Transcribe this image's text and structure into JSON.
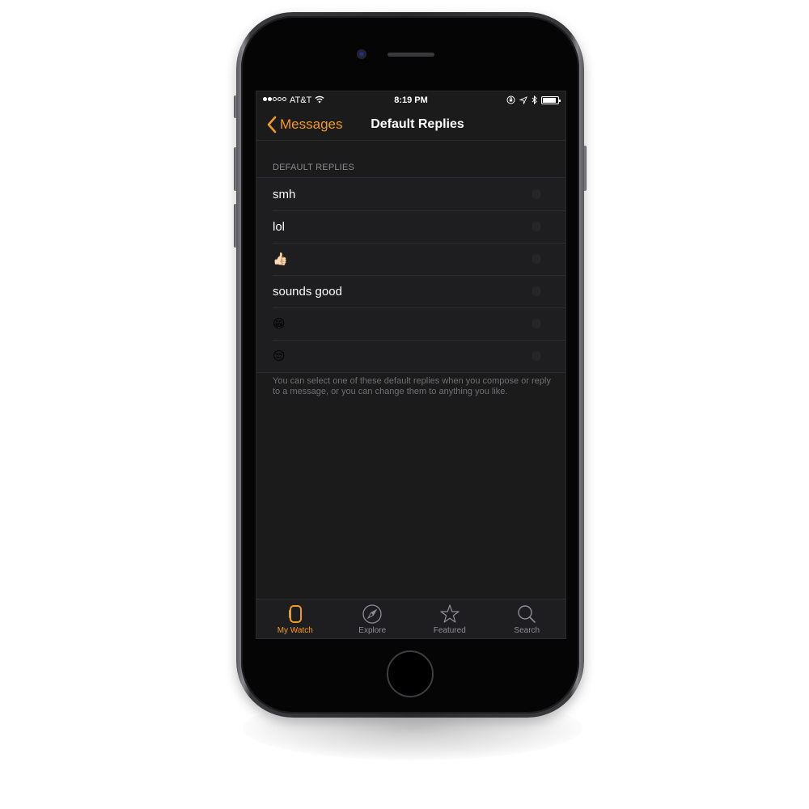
{
  "status_bar": {
    "signal_bars_filled": 2,
    "signal_bars_total": 5,
    "carrier": "AT&T",
    "time": "8:19 PM",
    "battery_level": 0.9,
    "icons": [
      "wifi-icon",
      "orientation-lock-icon",
      "location-icon",
      "bluetooth-icon",
      "battery-icon"
    ]
  },
  "nav": {
    "back_label": "Messages",
    "title": "Default Replies"
  },
  "section": {
    "header": "DEFAULT REPLIES",
    "items": [
      {
        "label": "smh",
        "type": "text"
      },
      {
        "label": "lol",
        "type": "text"
      },
      {
        "label": "👍🏻",
        "type": "emoji",
        "name": "thumbs-up"
      },
      {
        "label": "sounds good",
        "type": "text"
      },
      {
        "label": "😁",
        "type": "emoji",
        "name": "grinning-face"
      },
      {
        "label": "😒",
        "type": "emoji",
        "name": "unamused-face"
      }
    ],
    "footer": "You can select one of these default replies when you compose or reply to a message, or you can change them to anything you like."
  },
  "tab_bar": {
    "tabs": [
      {
        "label": "My Watch",
        "icon": "watch-icon",
        "active": true
      },
      {
        "label": "Explore",
        "icon": "compass-icon",
        "active": false
      },
      {
        "label": "Featured",
        "icon": "star-icon",
        "active": false
      },
      {
        "label": "Search",
        "icon": "search-icon",
        "active": false
      }
    ]
  },
  "colors": {
    "accent": "#f39a1b",
    "background": "#1b1b1c",
    "cell": "#1e1e20",
    "secondary_text": "#8a8a8e"
  }
}
